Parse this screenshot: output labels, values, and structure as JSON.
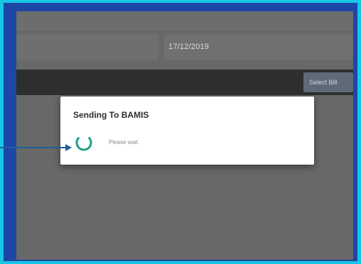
{
  "form": {
    "date_value": "17/12/2019"
  },
  "toolbar": {
    "select_label": "Select Bill"
  },
  "dialog": {
    "title": "Sending To BAMIS",
    "message": "Please wait.",
    "spinner_icon": "loading-spinner-icon",
    "spinner_color": "#1f9e86"
  },
  "annotation": {
    "arrow_icon": "arrow-right-icon",
    "arrow_color": "#1f5f9a"
  },
  "colors": {
    "outer_border": "#17c7e6",
    "inner_frame": "#1e46a6",
    "overlay": "#686868"
  }
}
